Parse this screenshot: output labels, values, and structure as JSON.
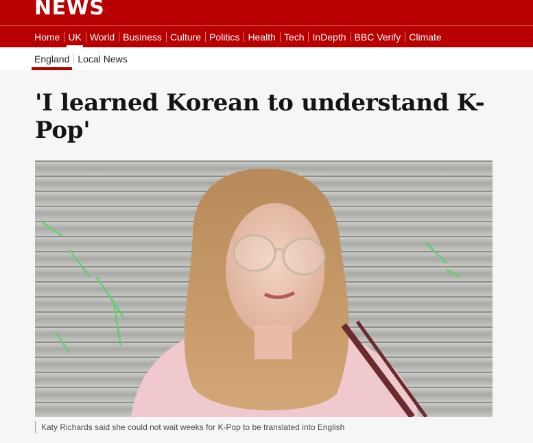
{
  "brand": {
    "logo_text": "NEWS"
  },
  "primary_nav": {
    "items": [
      {
        "label": "Home"
      },
      {
        "label": "UK"
      },
      {
        "label": "World"
      },
      {
        "label": "Business"
      },
      {
        "label": "Culture"
      },
      {
        "label": "Politics"
      },
      {
        "label": "Health"
      },
      {
        "label": "Tech"
      },
      {
        "label": "InDepth"
      },
      {
        "label": "BBC Verify"
      },
      {
        "label": "Climate"
      }
    ],
    "active": "UK"
  },
  "secondary_nav": {
    "items": [
      {
        "label": "England"
      },
      {
        "label": "Local News"
      }
    ],
    "active": "England"
  },
  "article": {
    "headline": "'I learned Korean to understand K-Pop'",
    "image_caption": "Katy Richards said she could not wait weeks for K-Pop to be translated into English"
  },
  "colors": {
    "brand_red": "#b80000",
    "page_background": "#f6f6f6"
  }
}
